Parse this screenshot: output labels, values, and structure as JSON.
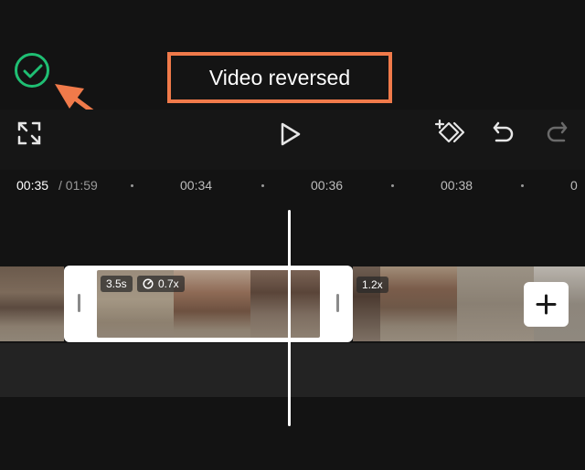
{
  "toast": {
    "text": "Video reversed"
  },
  "timeline": {
    "current_time": "00:35",
    "total_time": "/ 01:59",
    "ruler": [
      "00:34",
      "00:36",
      "00:38"
    ]
  },
  "clips": {
    "selected": {
      "duration": "3.5s",
      "speed": "0.7x"
    },
    "next": {
      "speed": "1.2x"
    }
  },
  "icons": {
    "confirm": "check-circle-icon",
    "fullscreen": "fullscreen-icon",
    "play": "play-icon",
    "keyframe": "add-keyframe-icon",
    "undo": "undo-icon",
    "redo": "redo-icon",
    "speed": "speed-gauge-icon",
    "add": "plus-icon"
  },
  "colors": {
    "confirm": "#1fbf73",
    "highlight": "#f07a4a",
    "background": "#131313"
  }
}
